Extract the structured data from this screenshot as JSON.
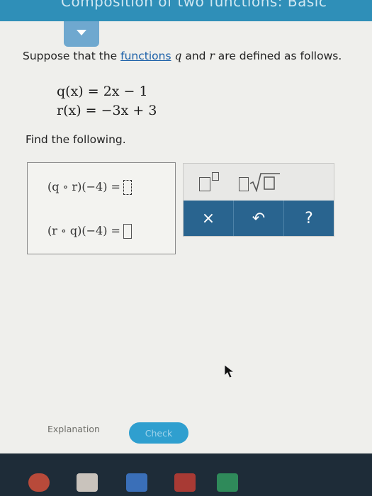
{
  "header": {
    "title": "Composition of two functions: Basic"
  },
  "problem": {
    "intro_before": "Suppose that the ",
    "link_text": "functions",
    "var_q": "q",
    "word_and": " and ",
    "var_r": "r",
    "intro_after": " are defined as follows.",
    "def_q": "q(x) = 2x − 1",
    "def_r": "r(x) = −3x + 3",
    "find_text": "Find the following."
  },
  "answers": {
    "expr1": "(q ∘ r)(−4) =",
    "expr2": "(r ∘ q)(−4) ="
  },
  "palette": {
    "clear_label": "×",
    "undo_label": "↶",
    "help_label": "?"
  },
  "footer": {
    "explanation_label": "Explanation",
    "check_label": "Check"
  },
  "colors": {
    "header": "#2f8fb8",
    "palette_bar": "#29648f",
    "check_button": "#2f9fcf",
    "link": "#1a5fa8"
  }
}
